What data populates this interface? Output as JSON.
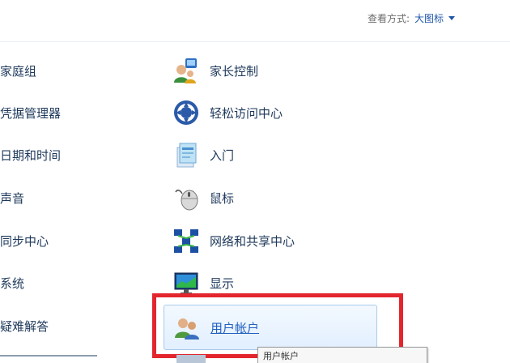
{
  "header": {
    "view_by_label": "查看方式:",
    "view_by_value": "大图标"
  },
  "left_items": [
    {
      "label": "家庭组"
    },
    {
      "label": "凭据管理器"
    },
    {
      "label": "日期和时间"
    },
    {
      "label": "声音"
    },
    {
      "label": "同步中心"
    },
    {
      "label": "系统"
    },
    {
      "label": "疑难解答"
    }
  ],
  "right_items": [
    {
      "label": "家长控制",
      "icon": "parental-controls-icon"
    },
    {
      "label": "轻松访问中心",
      "icon": "ease-of-access-icon"
    },
    {
      "label": "入门",
      "icon": "getting-started-icon"
    },
    {
      "label": "鼠标",
      "icon": "mouse-icon"
    },
    {
      "label": "网络和共享中心",
      "icon": "network-icon"
    },
    {
      "label": "显示",
      "icon": "display-icon"
    }
  ],
  "highlight_item": {
    "label": "用户帐户",
    "icon": "user-accounts-icon"
  },
  "tooltip": {
    "text": "用户帐户"
  },
  "colors": {
    "accent_red": "#e3262d",
    "link_blue": "#2060c0",
    "text": "#1e395b"
  }
}
